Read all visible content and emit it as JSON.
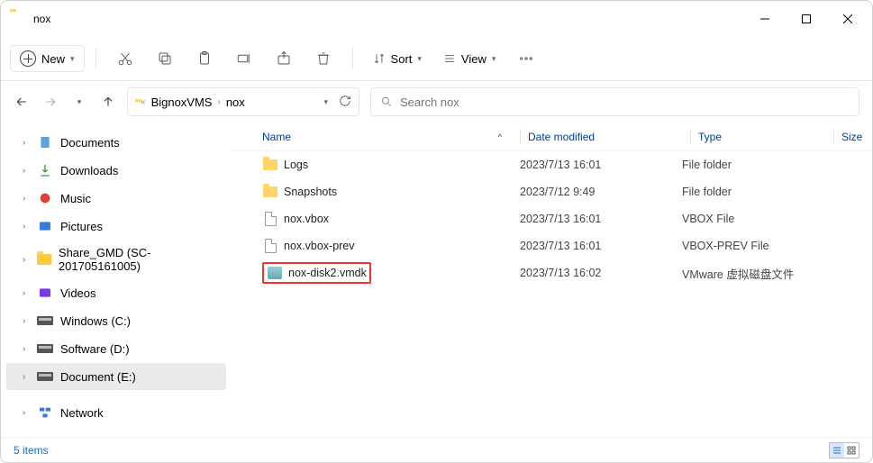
{
  "window": {
    "title": "nox"
  },
  "toolbar": {
    "new_label": "New",
    "sort_label": "Sort",
    "view_label": "View"
  },
  "breadcrumb": {
    "parts": [
      "BignoxVMS",
      "nox"
    ]
  },
  "search": {
    "placeholder": "Search nox"
  },
  "sidebar": {
    "items": [
      {
        "label": "Documents",
        "icon": "documents"
      },
      {
        "label": "Downloads",
        "icon": "downloads"
      },
      {
        "label": "Music",
        "icon": "music"
      },
      {
        "label": "Pictures",
        "icon": "pictures"
      },
      {
        "label": "Share_GMD (SC-201705161005)",
        "icon": "share"
      },
      {
        "label": "Videos",
        "icon": "videos"
      },
      {
        "label": "Windows (C:)",
        "icon": "drive"
      },
      {
        "label": "Software (D:)",
        "icon": "drive"
      },
      {
        "label": "Document (E:)",
        "icon": "drive",
        "selected": true
      },
      {
        "label": "Network",
        "icon": "network"
      }
    ]
  },
  "columns": {
    "name": "Name",
    "date": "Date modified",
    "type": "Type",
    "size": "Size"
  },
  "files": [
    {
      "name": "Logs",
      "date": "2023/7/13 16:01",
      "type": "File folder",
      "icon": "folder"
    },
    {
      "name": "Snapshots",
      "date": "2023/7/12 9:49",
      "type": "File folder",
      "icon": "folder"
    },
    {
      "name": "nox.vbox",
      "date": "2023/7/13 16:01",
      "type": "VBOX File",
      "icon": "file"
    },
    {
      "name": "nox.vbox-prev",
      "date": "2023/7/13 16:01",
      "type": "VBOX-PREV File",
      "icon": "file"
    },
    {
      "name": "nox-disk2.vmdk",
      "date": "2023/7/13 16:02",
      "type": "VMware 虚拟磁盘文件",
      "icon": "disk",
      "highlight": true
    }
  ],
  "status": {
    "count": "5 items"
  }
}
